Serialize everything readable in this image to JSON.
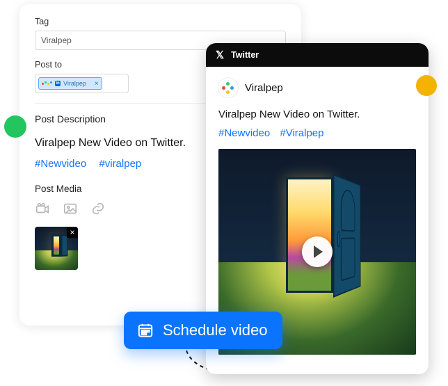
{
  "compose": {
    "tag_label": "Tag",
    "tag_value": "Viralpep",
    "post_to_label": "Post to",
    "account_chip": "Viralpep",
    "description_label": "Post Description",
    "description_text": "Viralpep New Video on Twitter.",
    "hashtags": [
      "#Newvideo",
      "#viralpep"
    ],
    "media_label": "Post Media"
  },
  "preview": {
    "platform": "Twitter",
    "account_name": "Viralpep",
    "text": "Viralpep New Video on Twitter.",
    "hashtags": [
      "#Newvideo",
      "#Viralpep"
    ]
  },
  "cta": {
    "schedule_label": "Schedule video"
  },
  "colors": {
    "accent": "#0b74ff",
    "green": "#22c55e",
    "yellow": "#f5b301"
  }
}
